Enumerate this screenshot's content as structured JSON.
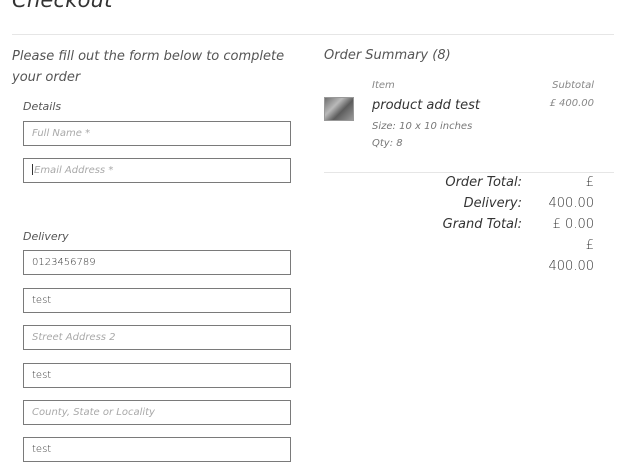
{
  "page": {
    "title": "Checkout",
    "intro": "Please fill out the form below to complete your order"
  },
  "details": {
    "label": "Details",
    "full_name_placeholder": "Full Name *",
    "email_placeholder": "Email Address *"
  },
  "delivery": {
    "label": "Delivery",
    "phone_value": "0123456789",
    "street1_value": "test",
    "street2_placeholder": "Street Address 2",
    "city_value": "test",
    "county_placeholder": "County, State or Locality",
    "postcode_value": "test"
  },
  "summary": {
    "title": "Order Summary (8)",
    "col_item": "Item",
    "col_subtotal": "Subtotal",
    "item": {
      "name": "product add test",
      "size": "Size: 10 x 10 inches",
      "qty": "Qty: 8",
      "subtotal": "£ 400.00",
      "thumbnail_icon": "product-image"
    },
    "order_total_label": "Order Total:",
    "order_total_currency": "£",
    "order_total_value": "400.00",
    "delivery_label": "Delivery:",
    "delivery_value": "400.00",
    "grand_total_label": "Grand Total:",
    "grand_total_line1": "£ 0.00",
    "grand_total_line2": "£",
    "grand_total_line3": "400.00"
  }
}
